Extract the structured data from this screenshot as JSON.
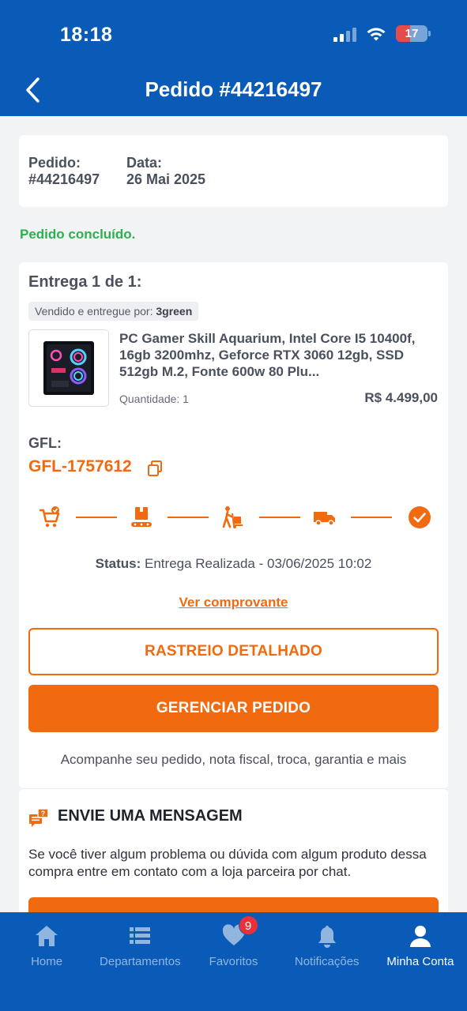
{
  "status_bar": {
    "time": "18:18",
    "battery": "17"
  },
  "header": {
    "title": "Pedido #44216497"
  },
  "order_info": {
    "order_label": "Pedido:",
    "order_value": "#44216497",
    "date_label": "Data:",
    "date_value": "26 Mai 2025"
  },
  "order_status": "Pedido concluído.",
  "delivery": {
    "title": "Entrega 1 de 1:",
    "seller_prefix": "Vendido e entregue por:",
    "seller_name": "3green",
    "product_name": "PC Gamer Skill Aquarium, Intel Core I5 10400f, 16gb 3200mhz, Geforce RTX 3060 12gb, SSD 512gb M.2, Fonte 600w 80 Plu...",
    "quantity": "Quantidade: 1",
    "price": "R$ 4.499,00",
    "gfl_label": "GFL:",
    "gfl_code": "GFL-1757612",
    "steps": [
      "cart-check-icon",
      "package-conveyor-icon",
      "hand-truck-icon",
      "truck-icon",
      "check-circle-icon"
    ],
    "status_label": "Status:",
    "status_value": "Entrega Realizada - 03/06/2025 10:02",
    "proof_link": "Ver comprovante",
    "track_button": "RASTREIO DETALHADO",
    "manage_button": "GERENCIAR PEDIDO",
    "hint": "Acompanhe seu pedido, nota fiscal,  troca, garantia e mais"
  },
  "message": {
    "title": "ENVIE UMA MENSAGEM",
    "text": "Se você tiver algum problema ou dúvida com algum produto dessa compra entre em contato com a loja parceira por chat."
  },
  "bottom_nav": {
    "items": [
      {
        "label": "Home",
        "icon": "home-icon"
      },
      {
        "label": "Departamentos",
        "icon": "list-icon"
      },
      {
        "label": "Favoritos",
        "icon": "heart-icon",
        "badge": "9"
      },
      {
        "label": "Notificações",
        "icon": "bell-icon"
      },
      {
        "label": "Minha Conta",
        "icon": "user-icon"
      }
    ],
    "active": "Minha Conta"
  },
  "colors": {
    "primary": "#0a5bb8",
    "accent": "#f26a0f",
    "success": "#2fb04f"
  }
}
